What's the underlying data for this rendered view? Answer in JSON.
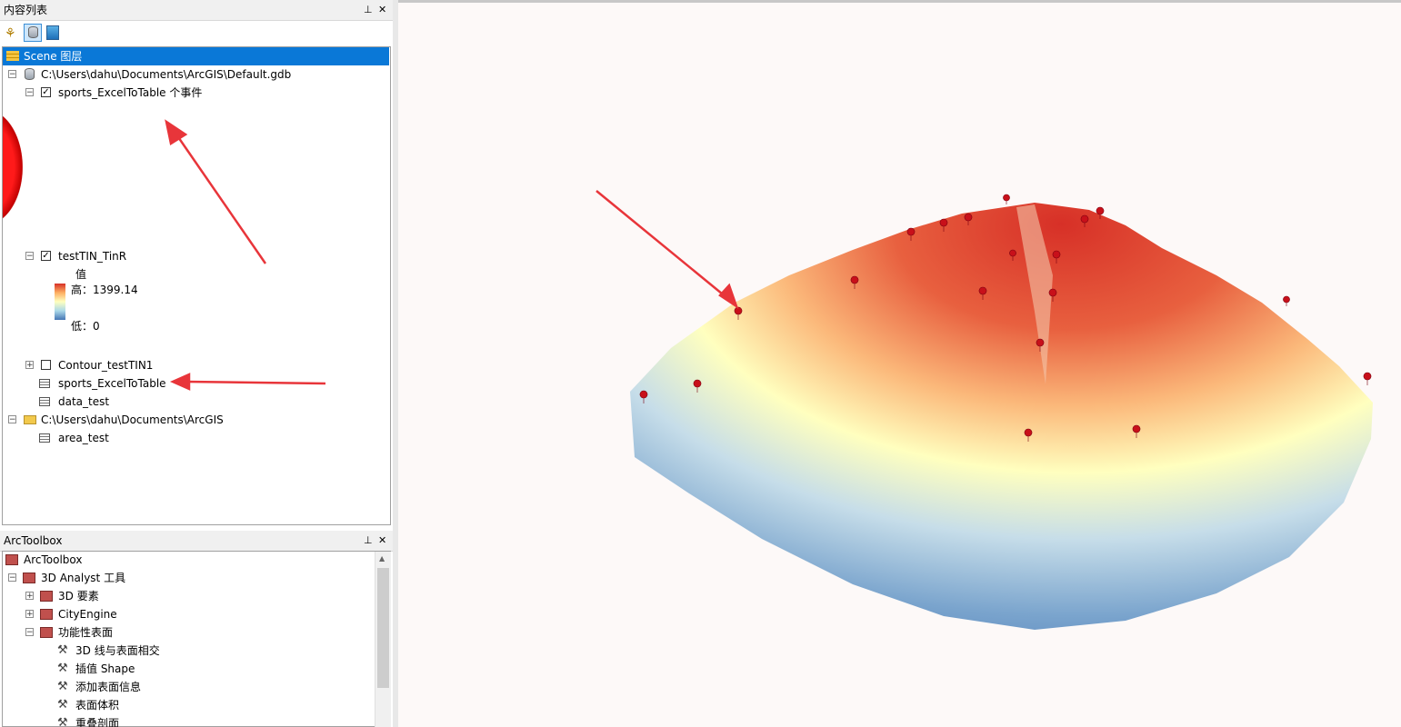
{
  "toc": {
    "title": "内容列表",
    "pin": "📌",
    "close": "✕",
    "rows": [
      {
        "label": "Scene 图层"
      },
      {
        "label": "C:\\Users\\dahu\\Documents\\ArcGIS\\Default.gdb"
      },
      {
        "label": "sports_ExcelToTable 个事件"
      },
      {
        "label": "testTIN_TinR"
      },
      {
        "label": "Contour_testTIN1"
      },
      {
        "label": "sports_ExcelToTable"
      },
      {
        "label": "data_test"
      },
      {
        "label": "C:\\Users\\dahu\\Documents\\ArcGIS"
      },
      {
        "label": "area_test"
      }
    ],
    "legend": {
      "field": "值",
      "high": "高：1399.14",
      "low": "低：0"
    }
  },
  "toolbox": {
    "title": "ArcToolbox",
    "pin": "📌",
    "close": "✕",
    "rows": [
      {
        "label": "ArcToolbox"
      },
      {
        "label": "3D Analyst 工具"
      },
      {
        "label": "3D 要素"
      },
      {
        "label": "CityEngine"
      },
      {
        "label": "功能性表面"
      },
      {
        "label": "3D 线与表面相交"
      },
      {
        "label": "插值 Shape"
      },
      {
        "label": "添加表面信息"
      },
      {
        "label": "表面体积"
      },
      {
        "label": "重叠剖面"
      }
    ]
  },
  "colors": {
    "selection": "#0a78d7",
    "arrow": "#e8353a",
    "ramp_high": "#d73027",
    "ramp_mid": "#ffffbf",
    "ramp_low": "#4575b4",
    "scene_bg": "#fdf9f8"
  }
}
